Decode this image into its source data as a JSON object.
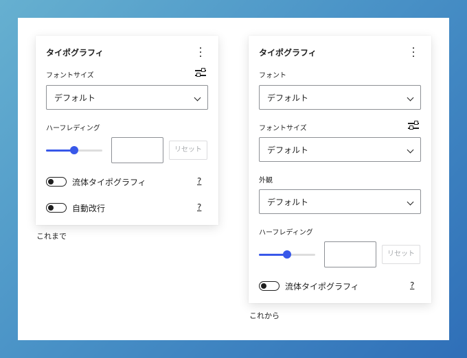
{
  "before": {
    "title": "タイポグラフィ",
    "font_size_label": "フォントサイズ",
    "font_size_value": "デフォルト",
    "line_height_label": "ハーフレディング",
    "slider_value_fraction": 0.5,
    "reset_label": "リセット",
    "fluid_label": "流体タイポグラフィ",
    "fluid_help": "?",
    "autowrap_label": "自動改行",
    "autowrap_help": "?",
    "caption": "これまで"
  },
  "after": {
    "title": "タイポグラフィ",
    "font_label": "フォント",
    "font_value": "デフォルト",
    "font_size_label": "フォントサイズ",
    "font_size_value": "デフォルト",
    "appearance_label": "外観",
    "appearance_value": "デフォルト",
    "line_height_label": "ハーフレディング",
    "slider_value_fraction": 0.5,
    "reset_label": "リセット",
    "fluid_label": "流体タイポグラフィ",
    "fluid_help": "?",
    "caption": "これから"
  },
  "colors": {
    "accent": "#3858e9",
    "text": "#1e1e1e",
    "border": "#8c8f94"
  }
}
